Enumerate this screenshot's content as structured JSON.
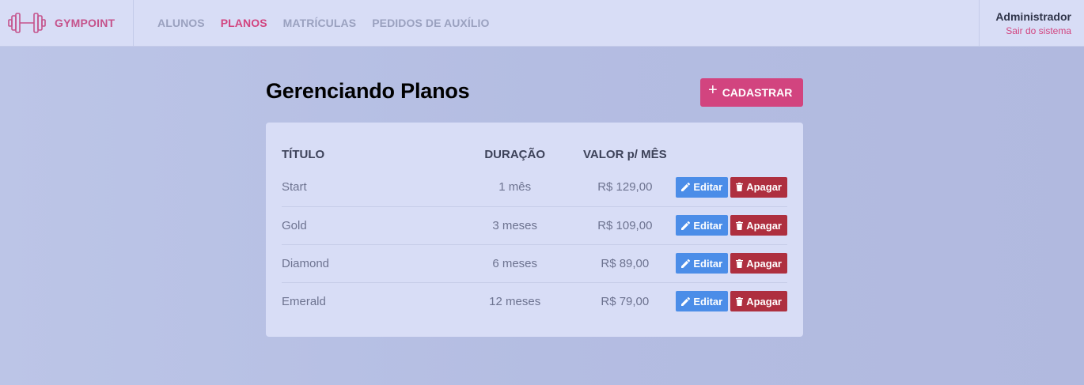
{
  "header": {
    "brand": "GYMPOINT",
    "nav": [
      {
        "label": "ALUNOS",
        "active": false
      },
      {
        "label": "PLANOS",
        "active": true
      },
      {
        "label": "MATRÍCULAS",
        "active": false
      },
      {
        "label": "PEDIDOS DE AUXÍLIO",
        "active": false
      }
    ],
    "user_name": "Administrador",
    "logout_label": "Sair do sistema"
  },
  "page": {
    "title": "Gerenciando Planos",
    "add_icon": "plus-icon",
    "add_label": "CADASTRAR"
  },
  "table": {
    "headers": {
      "title": "TÍTULO",
      "duration": "DURAÇÃO",
      "price": "VALOR p/ MÊS"
    },
    "rows": [
      {
        "title": "Start",
        "duration": "1 mês",
        "price": "R$ 129,00"
      },
      {
        "title": "Gold",
        "duration": "3 meses",
        "price": "R$ 109,00"
      },
      {
        "title": "Diamond",
        "duration": "6 meses",
        "price": "R$ 89,00"
      },
      {
        "title": "Emerald",
        "duration": "12 meses",
        "price": "R$ 79,00"
      }
    ],
    "edit_label": "Editar",
    "delete_label": "Apagar",
    "edit_icon": "pencil-icon",
    "delete_icon": "trash-icon"
  },
  "colors": {
    "accent": "#d2447f",
    "edit_button": "#4b8de8",
    "delete_button": "#ae2f3f",
    "header_bg": "#d8ddf6",
    "page_bg": "#b6bfe3"
  }
}
